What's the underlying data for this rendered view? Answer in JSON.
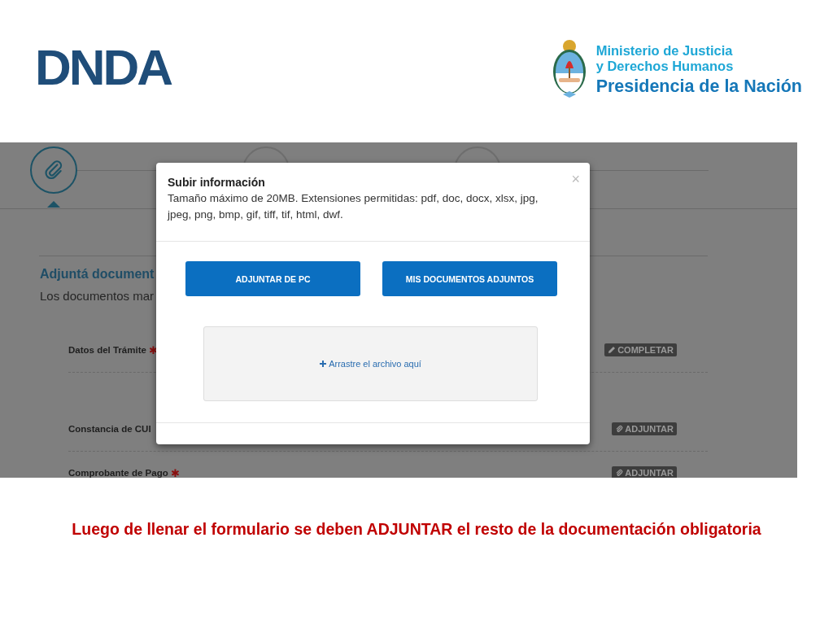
{
  "header": {
    "logo": "DNDA",
    "ministry": [
      "Ministerio de Justicia",
      "y Derechos Humanos"
    ],
    "presidency": "Presidencia de la Nación"
  },
  "screen": {
    "steps": [
      {
        "selected": true
      },
      {
        "selected": false
      },
      {
        "selected": false
      }
    ],
    "section_title": "Adjuntá document",
    "section_text": "Los documentos mar",
    "rows": [
      {
        "label": "Datos del Trámite",
        "required_mark": "✱",
        "action": "COMPLETAR",
        "kind": "edit"
      },
      {
        "label": "Constancia de CUI",
        "action": "ADJUNTAR",
        "kind": "attach"
      },
      {
        "label": "Comprobante de Pago",
        "required_mark": "✱",
        "action": "ADJUNTAR",
        "kind": "attach"
      }
    ],
    "dialog": {
      "title": "Subir información",
      "description": "Tamaño máximo de 20MB. Extensiones permitidas: pdf, doc, docx, xlsx, jpg, jpeg, png, bmp, gif, tiff, tif, html, dwf.",
      "close": "×",
      "buttons": [
        "ADJUNTAR DE PC",
        "MIS DOCUMENTOS ADJUNTOS"
      ],
      "dropzone": "Arrastre el archivo aquí"
    }
  },
  "caption": "Luego de llenar el formulario se deben ADJUNTAR el resto de la documentación obligatoria"
}
